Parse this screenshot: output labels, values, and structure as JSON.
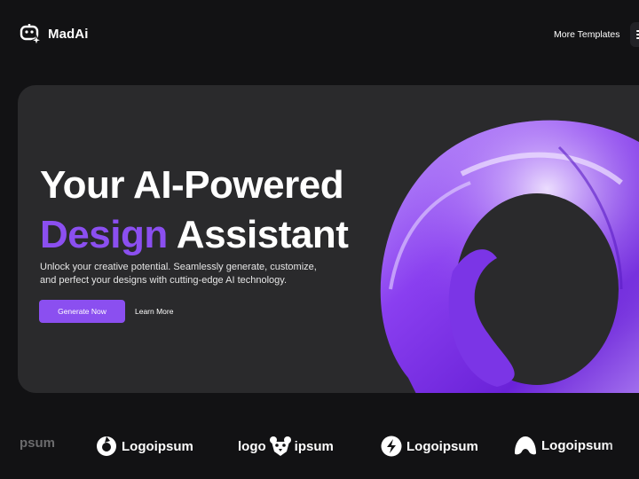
{
  "header": {
    "brand": {
      "name": "MadAi",
      "icon": "robot-sparkle-icon"
    },
    "nav": [
      {
        "label": "More Templates"
      }
    ],
    "menu_icon": "menu-icon"
  },
  "hero": {
    "title_line1": "Your AI-Powered",
    "title_accent": "Design",
    "title_line2_rest": "Assistant",
    "description": "Unlock your creative potential. Seamlessly generate, customize, and perfect your designs with cutting-edge AI technology.",
    "primary_button": "Generate Now",
    "secondary_button": "Learn More",
    "image": "purple-glass-swirl-3d"
  },
  "logos": [
    {
      "text": "psum",
      "icon": "none",
      "faded": true
    },
    {
      "text": "Logoipsum",
      "icon": "ring-logo-icon"
    },
    {
      "text_left": "logo",
      "text_right": "ipsum",
      "icon": "bear-logo-icon"
    },
    {
      "text": "Logoipsum",
      "icon": "bolt-logo-icon"
    },
    {
      "text": "Logoipsum",
      "icon": "arch-logo-icon"
    }
  ],
  "colors": {
    "accent": "#8b4ff0",
    "background": "#121214",
    "card": "#2a2a2c"
  }
}
